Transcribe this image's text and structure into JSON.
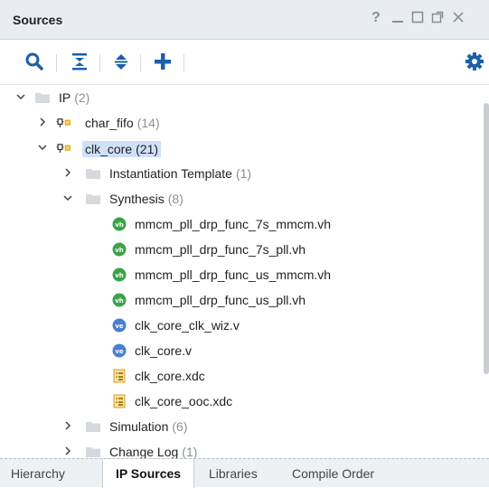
{
  "panel": {
    "title": "Sources",
    "window_controls": [
      "?",
      "minimize",
      "restore",
      "float",
      "close"
    ]
  },
  "toolbar": {
    "buttons": [
      "search-icon",
      "collapse-all-icon",
      "expand-all-icon",
      "add-icon"
    ],
    "right_button": "gear-icon"
  },
  "tree": {
    "ip": {
      "label": "IP",
      "count": "(2)"
    },
    "char_fifo": {
      "label": "char_fifo",
      "count": "(14)"
    },
    "clk_core": {
      "label": "clk_core",
      "count": "(21)"
    },
    "instantiation": {
      "label": "Instantiation Template",
      "count": "(1)"
    },
    "synthesis": {
      "label": "Synthesis",
      "count": "(8)"
    },
    "files": [
      {
        "label": "mmcm_pll_drp_func_7s_mmcm.vh",
        "type": "vh"
      },
      {
        "label": "mmcm_pll_drp_func_7s_pll.vh",
        "type": "vh"
      },
      {
        "label": "mmcm_pll_drp_func_us_mmcm.vh",
        "type": "vh"
      },
      {
        "label": "mmcm_pll_drp_func_us_pll.vh",
        "type": "vh"
      },
      {
        "label": "clk_core_clk_wiz.v",
        "type": "v"
      },
      {
        "label": "clk_core.v",
        "type": "v"
      },
      {
        "label": "clk_core.xdc",
        "type": "xdc"
      },
      {
        "label": "clk_core_ooc.xdc",
        "type": "xdc"
      }
    ],
    "simulation": {
      "label": "Simulation",
      "count": "(6)"
    },
    "changelog": {
      "label": "Change Log",
      "count": "(1)"
    }
  },
  "tabs": [
    {
      "label": "Hierarchy",
      "active": false
    },
    {
      "label": "IP Sources",
      "active": true
    },
    {
      "label": "Libraries",
      "active": false
    },
    {
      "label": "Compile Order",
      "active": false
    }
  ],
  "colors": {
    "selection": "#cfe0f8",
    "count_text": "#8a8f96",
    "vh_icon": "#3aa34a",
    "v_icon": "#4a7fd0",
    "xdc_icon": "#d9a21c",
    "ip_icon": "#e0b020"
  }
}
